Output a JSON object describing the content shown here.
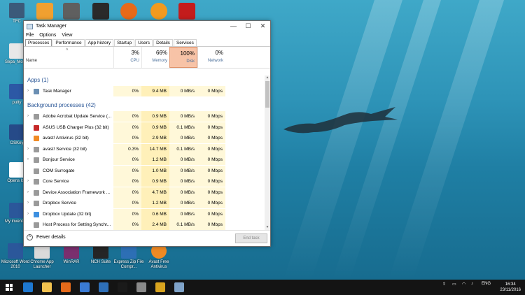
{
  "desktop": {
    "icons": [
      {
        "label": "TFC",
        "color": "#3b5a7a"
      },
      {
        "label": "Sepa_Mon...",
        "color": "#e8e8e8"
      },
      {
        "label": "putty",
        "color": "#2c58a5"
      },
      {
        "label": "OSKey",
        "color": "#264a88"
      },
      {
        "label": "Opens log",
        "color": "#ffffff"
      },
      {
        "label": "My inventory",
        "color": "#2b579a"
      }
    ],
    "top_icons": [
      {
        "name": "sync-app",
        "color": "#f0a030"
      },
      {
        "name": "calculator",
        "color": "#5f5f5f"
      },
      {
        "name": "audio-editor",
        "color": "#2a2a2a"
      },
      {
        "name": "firefox",
        "color": "#e66a1a"
      },
      {
        "name": "flame-app",
        "color": "#f29a1f"
      },
      {
        "name": "acrobat",
        "color": "#c41c1c"
      }
    ],
    "bottom_icons": [
      {
        "label": "Microsoft Word 2010",
        "color": "#2b579a"
      },
      {
        "label": "Chrome App Launcher",
        "color": "#dadada"
      },
      {
        "label": "WinRAR",
        "color": "#7a2f6e"
      },
      {
        "label": "NCH Suite",
        "color": "#252525"
      },
      {
        "label": "Express Zip File Compr...",
        "color": "#2d6fb5"
      },
      {
        "label": "Avast Free Antivirus",
        "color": "#f08a24"
      }
    ]
  },
  "window": {
    "title": "Task Manager",
    "buttons": {
      "minimize": "—",
      "maximize": "☐",
      "close": "✕"
    },
    "menu": [
      "File",
      "Options",
      "View"
    ],
    "tabs": [
      "Processes",
      "Performance",
      "App history",
      "Startup",
      "Users",
      "Details",
      "Services"
    ],
    "active_tab": "Processes"
  },
  "columns": {
    "name": "Name",
    "cpu": {
      "pct": "3%",
      "label": "CPU"
    },
    "memory": {
      "pct": "66%",
      "label": "Memory"
    },
    "disk": {
      "pct": "100%",
      "label": "Disk"
    },
    "network": {
      "pct": "0%",
      "label": "Network"
    }
  },
  "groups": {
    "apps": "Apps (1)",
    "background": "Background processes (42)"
  },
  "apps": [
    {
      "name": "Task Manager",
      "cpu": "0%",
      "mem": "9.4 MB",
      "disk": "0 MB/s",
      "net": "0 Mbps",
      "expand": true,
      "icon_color": "#6b8fb3"
    }
  ],
  "processes": [
    {
      "name": "Adobe Acrobat Update Service (...",
      "cpu": "0%",
      "mem": "0.9 MB",
      "disk": "0 MB/s",
      "net": "0 Mbps",
      "expand": true,
      "icon_color": "#9a9a9a"
    },
    {
      "name": "ASUS USB Charger Plus (32 bit)",
      "cpu": "0%",
      "mem": "0.9 MB",
      "disk": "0.1 MB/s",
      "net": "0 Mbps",
      "expand": false,
      "icon_color": "#c62828"
    },
    {
      "name": "avast! Antivirus (32 bit)",
      "cpu": "0%",
      "mem": "2.9 MB",
      "disk": "0 MB/s",
      "net": "0 Mbps",
      "expand": false,
      "icon_color": "#f08a24"
    },
    {
      "name": "avast! Service (32 bit)",
      "cpu": "0.3%",
      "mem": "14.7 MB",
      "disk": "0.1 MB/s",
      "net": "0 Mbps",
      "expand": true,
      "icon_color": "#9a9a9a"
    },
    {
      "name": "Bonjour Service",
      "cpu": "0%",
      "mem": "1.2 MB",
      "disk": "0 MB/s",
      "net": "0 Mbps",
      "expand": true,
      "icon_color": "#9a9a9a"
    },
    {
      "name": "COM Surrogate",
      "cpu": "0%",
      "mem": "1.0 MB",
      "disk": "0 MB/s",
      "net": "0 Mbps",
      "expand": false,
      "icon_color": "#9a9a9a"
    },
    {
      "name": "Core Service",
      "cpu": "0%",
      "mem": "0.9 MB",
      "disk": "0 MB/s",
      "net": "0 Mbps",
      "expand": true,
      "icon_color": "#9a9a9a"
    },
    {
      "name": "Device Association Framework ...",
      "cpu": "0%",
      "mem": "4.7 MB",
      "disk": "0 MB/s",
      "net": "0 Mbps",
      "expand": true,
      "icon_color": "#9a9a9a"
    },
    {
      "name": "Dropbox Service",
      "cpu": "0%",
      "mem": "1.2 MB",
      "disk": "0 MB/s",
      "net": "0 Mbps",
      "expand": true,
      "icon_color": "#9a9a9a"
    },
    {
      "name": "Dropbox Update (32 bit)",
      "cpu": "0%",
      "mem": "0.6 MB",
      "disk": "0 MB/s",
      "net": "0 Mbps",
      "expand": true,
      "icon_color": "#3d8fe0"
    },
    {
      "name": "Host Process for Setting Synchr...",
      "cpu": "0%",
      "mem": "2.4 MB",
      "disk": "0.1 MB/s",
      "net": "0 Mbps",
      "expand": false,
      "icon_color": "#9a9a9a"
    }
  ],
  "footer": {
    "fewer": "Fewer details",
    "end_task": "End task"
  },
  "taskbar": {
    "apps": [
      {
        "name": "edge",
        "color": "#1e78d0"
      },
      {
        "name": "file-explorer",
        "color": "#f2c14e"
      },
      {
        "name": "firefox",
        "color": "#e66a1a"
      },
      {
        "name": "store",
        "color": "#3a7bd5"
      },
      {
        "name": "mail",
        "color": "#2e6fb8"
      },
      {
        "name": "cmd",
        "color": "#1a1a1a"
      },
      {
        "name": "bug-app",
        "color": "#8a8a8a"
      },
      {
        "name": "chrome",
        "color": "#d9a41f"
      },
      {
        "name": "task-manager",
        "color": "#7fa3c9"
      }
    ],
    "lang": "ENG",
    "time": "16:34",
    "date": "23/11/2016"
  }
}
